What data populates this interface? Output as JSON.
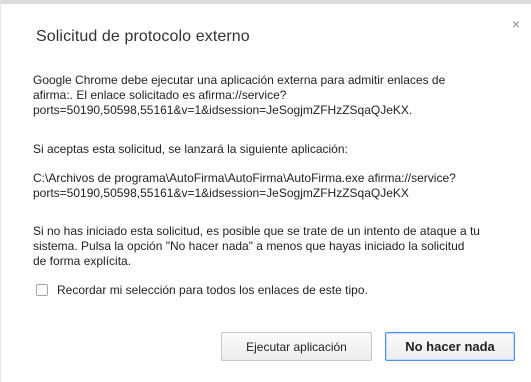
{
  "dialog": {
    "title": "Solicitud de protocolo externo",
    "close_symbol": "×",
    "paragraphs": [
      "Google Chrome debe ejecutar una aplicación externa para admitir enlaces de\nafirma:. El enlace solicitado es afirma://service?\nports=50190,50598,55161&v=1&idsession=JeSogjmZFHzZSqaQJeKX.",
      "Si aceptas esta solicitud, se lanzará la siguiente aplicación:",
      "C:\\Archivos de programa\\AutoFirma\\AutoFirma\\AutoFirma.exe afirma://service?\nports=50190,50598,55161&v=1&idsession=JeSogjmZFHzZSqaQJeKX",
      "Si no has iniciado esta solicitud, es posible que se trate de un intento de ataque a tu\nsistema. Pulsa la opción \"No hacer nada\" a menos que hayas iniciado la solicitud\nde forma explícita."
    ],
    "remember_checkbox": {
      "label": "Recordar mi selección para todos los enlaces de este tipo.",
      "checked": false
    },
    "buttons": {
      "run": "Ejecutar aplicación",
      "do_nothing": "No hacer nada"
    }
  },
  "colors": {
    "focus_border": "#4d90fe",
    "text": "#222222",
    "close_icon": "#8c8c8c"
  }
}
